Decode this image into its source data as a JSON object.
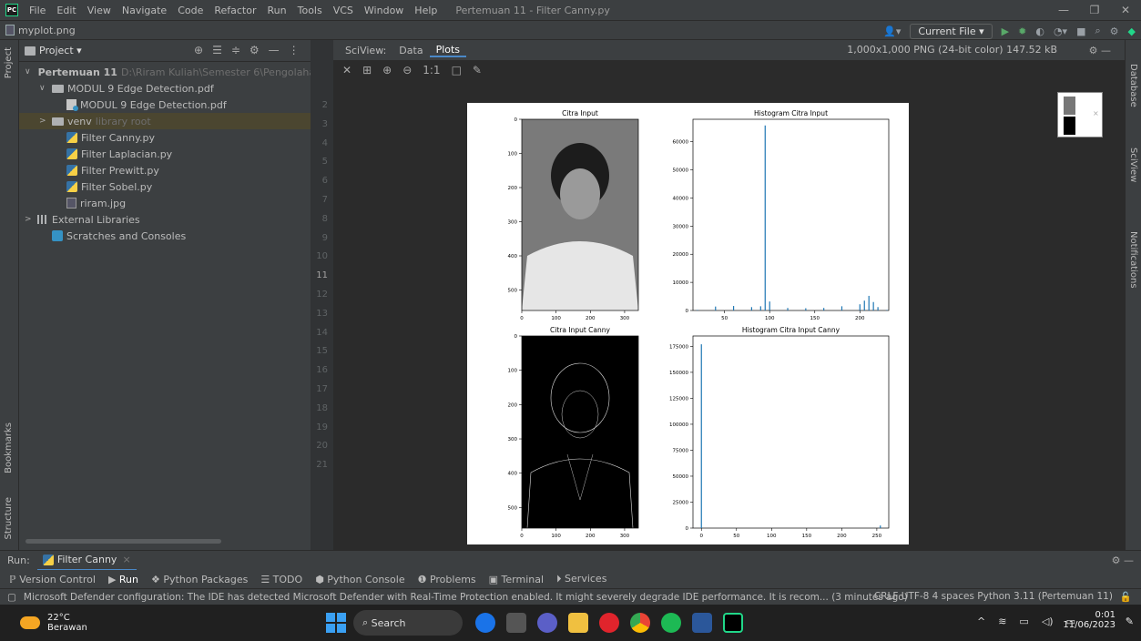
{
  "window": {
    "logo": "PC",
    "menus": [
      "File",
      "Edit",
      "View",
      "Navigate",
      "Code",
      "Refactor",
      "Run",
      "Tools",
      "VCS",
      "Window",
      "Help"
    ],
    "title": "Pertemuan 11 - Filter Canny.py"
  },
  "navbar": {
    "breadcrumb": "myplot.png",
    "run_config": "Current File ▾"
  },
  "project": {
    "header": "Project ▾",
    "tree": [
      {
        "label": "Pertemuan 11",
        "extra": "D:\\Riram Kuliah\\Semester 6\\Pengolahan...",
        "kind": "folder",
        "indent": 0,
        "arrow": "∨"
      },
      {
        "label": "MODUL 9 Edge Detection.pdf",
        "extra": "",
        "kind": "folder",
        "indent": 1,
        "arrow": "∨"
      },
      {
        "label": "MODUL 9 Edge Detection.pdf",
        "extra": "",
        "kind": "pdf",
        "indent": 2,
        "arrow": ""
      },
      {
        "label": "venv",
        "extra": "library root",
        "kind": "folder",
        "indent": 1,
        "arrow": ">"
      },
      {
        "label": "Filter Canny.py",
        "extra": "",
        "kind": "py",
        "indent": 2,
        "arrow": ""
      },
      {
        "label": "Filter Laplacian.py",
        "extra": "",
        "kind": "py",
        "indent": 2,
        "arrow": ""
      },
      {
        "label": "Filter Prewitt.py",
        "extra": "",
        "kind": "py",
        "indent": 2,
        "arrow": ""
      },
      {
        "label": "Filter Sobel.py",
        "extra": "",
        "kind": "py",
        "indent": 2,
        "arrow": ""
      },
      {
        "label": "riram.jpg",
        "extra": "",
        "kind": "img",
        "indent": 2,
        "arrow": ""
      },
      {
        "label": "External Libraries",
        "extra": "",
        "kind": "lib",
        "indent": 0,
        "arrow": ">"
      },
      {
        "label": "Scratches and Consoles",
        "extra": "",
        "kind": "scratch",
        "indent": 1,
        "arrow": ""
      }
    ]
  },
  "left_strip": {
    "project": "Project",
    "bookmarks": "Bookmarks",
    "structure": "Structure"
  },
  "right_strip": {
    "database": "Database",
    "sciview": "SciView",
    "notifications": "Notifications"
  },
  "gutter": {
    "lines": [
      "2",
      "3",
      "4",
      "5",
      "6",
      "7",
      "8",
      "9",
      "10",
      "11",
      "12",
      "13",
      "14",
      "15",
      "16",
      "17",
      "18",
      "19",
      "20",
      "21"
    ]
  },
  "sciview": {
    "label": "SciView:",
    "tabs": [
      "Data",
      "Plots"
    ],
    "info": "1,000x1,000 PNG (24-bit color) 147.52 kB",
    "tools": [
      "✕",
      "⊞",
      "⊕",
      "⊖",
      "1:1",
      "□",
      "✎"
    ]
  },
  "chart_data": [
    {
      "type": "image",
      "title": "Citra Input",
      "xticks": [
        "0",
        "100",
        "200",
        "300"
      ],
      "yticks": [
        "0",
        "100",
        "200",
        "300",
        "400",
        "500"
      ]
    },
    {
      "type": "bar",
      "title": "Histogram Citra Input",
      "xticks": [
        "50",
        "100",
        "150",
        "200"
      ],
      "yticks": [
        "0",
        "10000",
        "20000",
        "30000",
        "40000",
        "50000",
        "60000"
      ],
      "x": [
        20,
        40,
        60,
        80,
        90,
        95,
        100,
        120,
        140,
        160,
        180,
        200,
        205,
        210,
        215,
        220,
        230
      ],
      "values": [
        200,
        1400,
        1600,
        1200,
        1500,
        65800,
        3200,
        900,
        800,
        900,
        1500,
        2200,
        3500,
        5200,
        3000,
        1200,
        200
      ],
      "xlim": [
        15,
        232
      ],
      "ylim": [
        0,
        68000
      ]
    },
    {
      "type": "image",
      "title": "Citra Input Canny",
      "xticks": [
        "0",
        "100",
        "200",
        "300"
      ],
      "yticks": [
        "0",
        "100",
        "200",
        "300",
        "400",
        "500"
      ]
    },
    {
      "type": "bar",
      "title": "Histogram Citra Input Canny",
      "xticks": [
        "0",
        "50",
        "100",
        "150",
        "200",
        "250"
      ],
      "yticks": [
        "0",
        "25000",
        "50000",
        "75000",
        "100000",
        "125000",
        "150000",
        "175000"
      ],
      "x": [
        0,
        255
      ],
      "values": [
        177000,
        2500
      ],
      "xlim": [
        -12,
        267
      ],
      "ylim": [
        0,
        185000
      ]
    }
  ],
  "run": {
    "label": "Run:",
    "tab": "Filter Canny",
    "close": "×"
  },
  "toolwindows": [
    "Version Control",
    "Run",
    "Python Packages",
    "TODO",
    "Python Console",
    "Problems",
    "Terminal",
    "Services"
  ],
  "status": {
    "message": "Microsoft Defender configuration: The IDE has detected Microsoft Defender with Real-Time Protection enabled. It might severely degrade IDE performance. It is recom... (3 minutes ago)",
    "encoding": "CRLF  UTF-8  4 spaces  Python 3.11 (Pertemuan 11)"
  },
  "taskbar": {
    "temp": "22°C",
    "weather": "Berawan",
    "search": "Search",
    "time": "0:01",
    "date": "11/06/2023"
  },
  "colors": {
    "accent": "#4a88c7",
    "hist": "#1f77b4",
    "green": "#59a869"
  }
}
